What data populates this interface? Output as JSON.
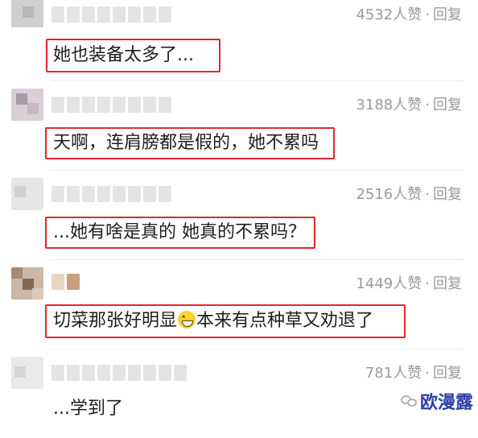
{
  "comments": [
    {
      "likes": "4532人赞",
      "sep": "·",
      "reply": "回复",
      "text": "她也装备太多了..."
    },
    {
      "likes": "3188人赞",
      "sep": "·",
      "reply": "回复",
      "text": "天啊，连肩膀都是假的，她不累吗"
    },
    {
      "likes": "2516人赞",
      "sep": "·",
      "reply": "回复",
      "text": "...她有啥是真的 她真的不累吗？"
    },
    {
      "likes": "1449人赞",
      "sep": "·",
      "reply": "回复",
      "text_before": "切菜那张好明显",
      "emoji": "grinning-sweat-emoji",
      "text_after": "本来有点种草又劝退了"
    },
    {
      "likes": "781人赞",
      "sep": "·",
      "reply": "回复",
      "text": "...学到了"
    }
  ],
  "watermark": {
    "text": "欧漫露",
    "icon": "wechat-icon"
  },
  "colors": {
    "highlight": "#e0262f",
    "meta": "#9a9a9a",
    "watermark": "#2d3fa8"
  }
}
